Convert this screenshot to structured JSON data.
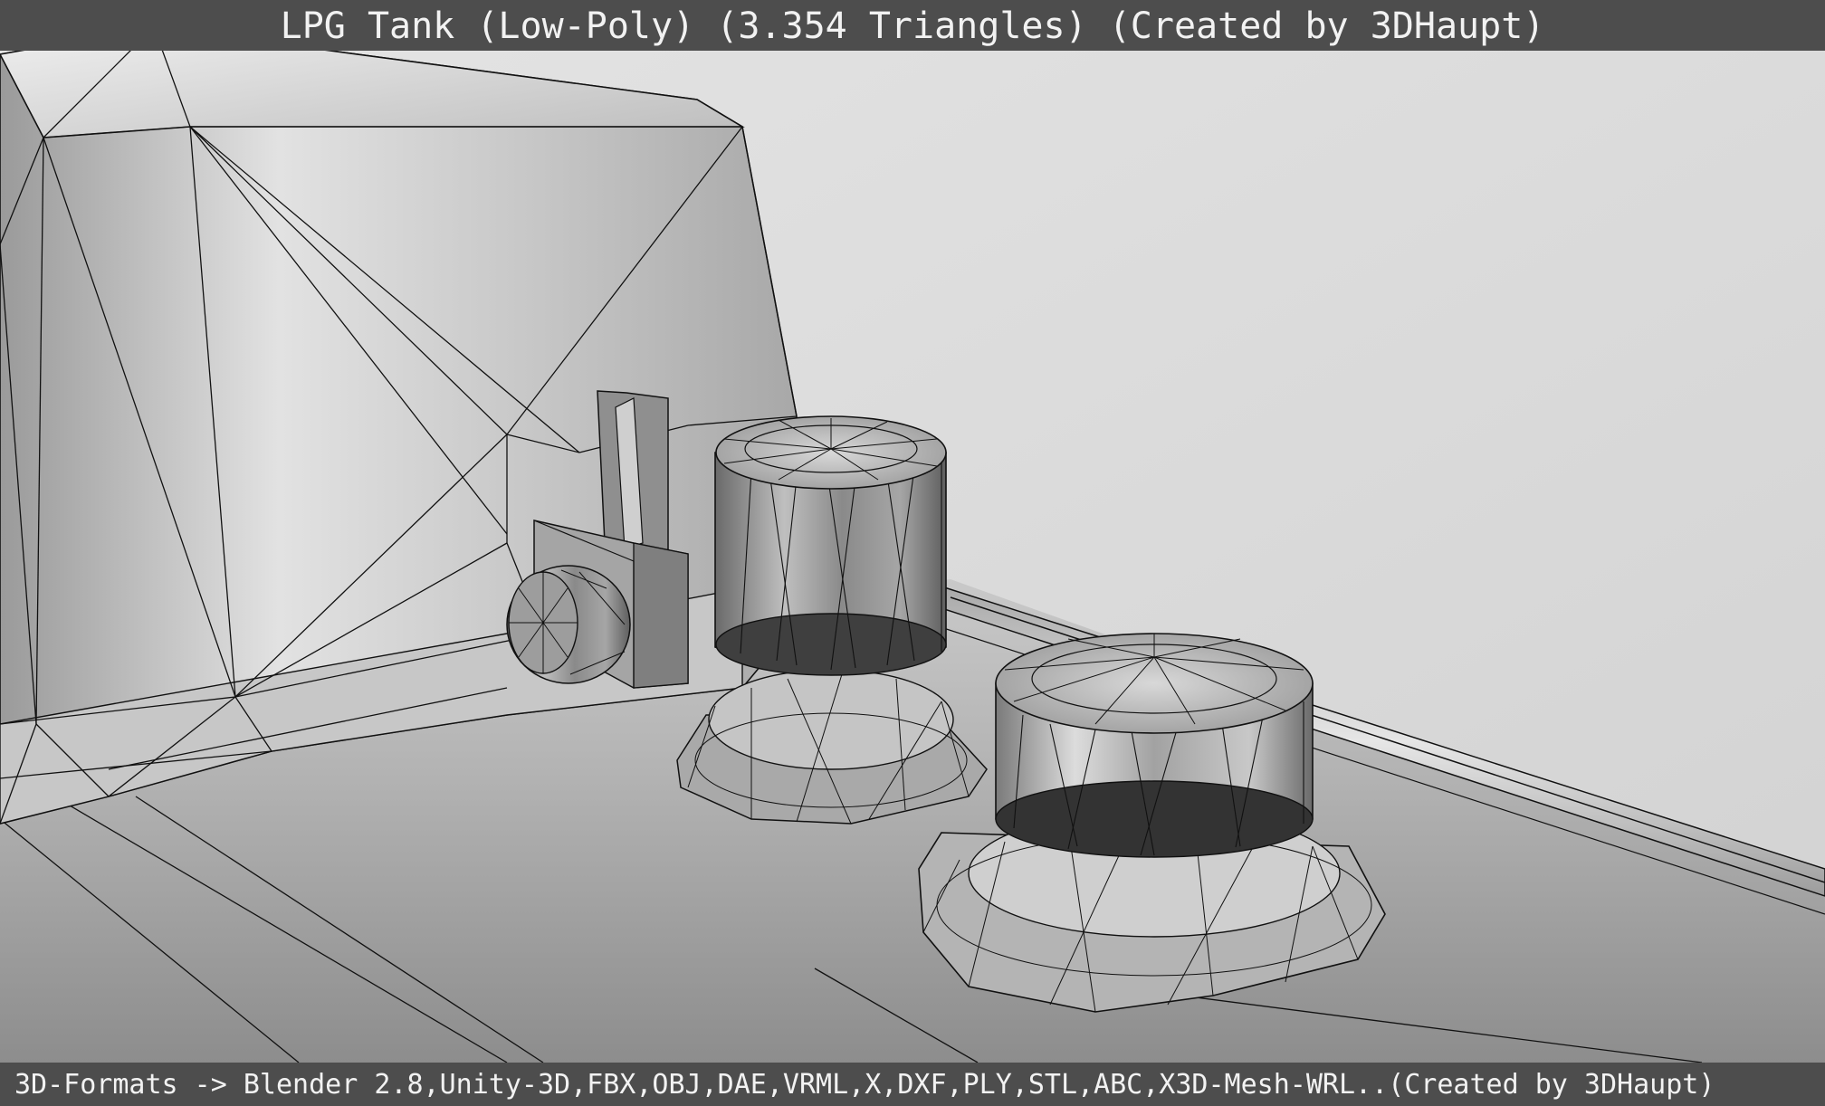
{
  "header": {
    "title": "LPG Tank (Low-Poly) (3.354 Triangles) (Created by 3DHaupt)"
  },
  "footer": {
    "formats": "3D-Formats -> Blender 2.8,Unity-3D,FBX,OBJ,DAE,VRML,X,DXF,PLY,STL,ABC,X3D-Mesh-WRL..(Created by 3DHaupt)"
  },
  "colors": {
    "bar_background": "#4d4d4d",
    "bar_text": "#f2f2f2",
    "backdrop": "#dcdcdc",
    "metal": "#b5b5b5",
    "wireframe": "#111111"
  },
  "scene": {
    "subject": "lpg-tank-low-poly",
    "shading": "grey-metal-with-black-wireframe"
  }
}
